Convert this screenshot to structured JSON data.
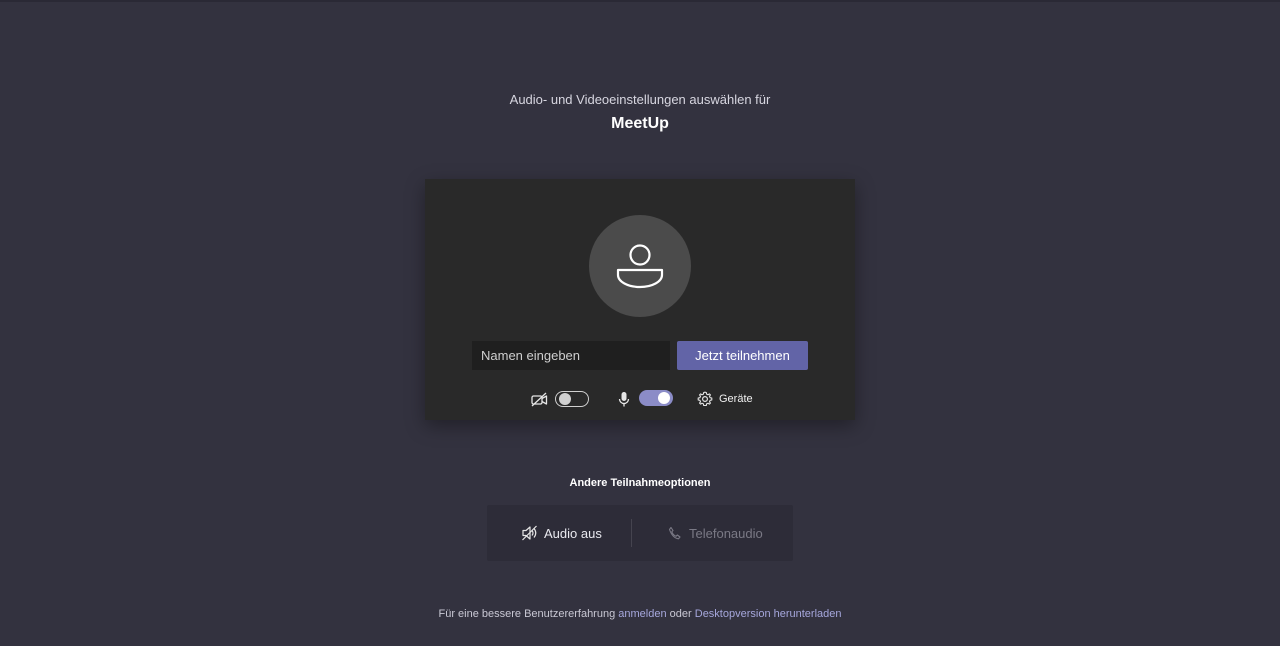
{
  "header": {
    "subtitle": "Audio- und Videoeinstellungen auswählen für",
    "meeting_title": "MeetUp"
  },
  "prejoin": {
    "avatar_icon": "person-icon",
    "name_input": {
      "value": "",
      "placeholder": "Namen eingeben"
    },
    "join_label": "Jetzt teilnehmen",
    "camera": {
      "icon": "camera-off-icon",
      "enabled": false
    },
    "microphone": {
      "icon": "microphone-icon",
      "enabled": true
    },
    "devices": {
      "icon": "gear-icon",
      "label": "Geräte"
    }
  },
  "other_options": {
    "title": "Andere Teilnahmeoptionen",
    "audio_off": {
      "icon": "speaker-off-icon",
      "label": "Audio aus"
    },
    "phone_audio": {
      "icon": "phone-icon",
      "label": "Telefonaudio",
      "disabled": true
    }
  },
  "footer": {
    "prefix": "Für eine bessere Benutzererfahrung",
    "signin_link": "anmelden",
    "middle": "oder",
    "desktop_link": "Desktopversion herunterladen"
  },
  "colors": {
    "background": "#33323f",
    "card": "#292929",
    "accent": "#6264a7",
    "toggle_on": "#8b8cc7",
    "link": "#a6a7dc"
  }
}
